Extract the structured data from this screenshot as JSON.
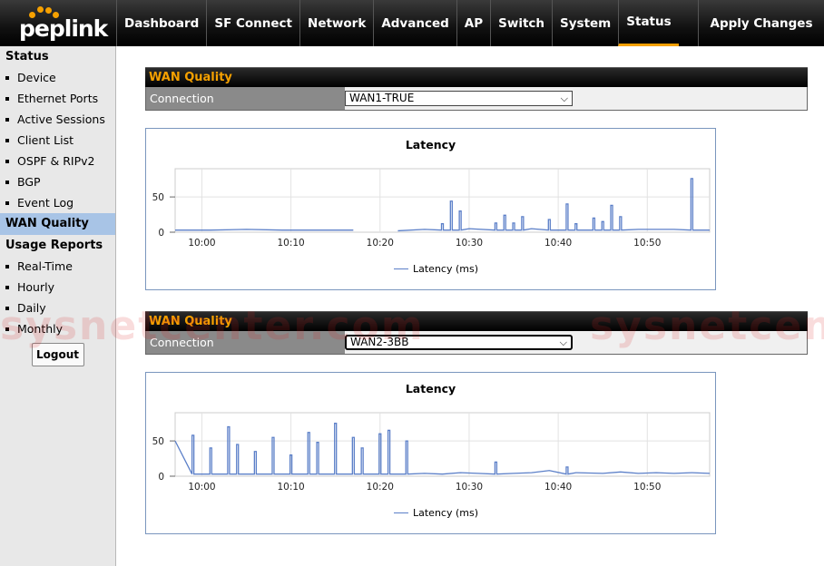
{
  "brand": {
    "logo_text": "peplink",
    "accent": "#f5a000"
  },
  "nav": {
    "items": [
      "Dashboard",
      "SF Connect",
      "Network",
      "Advanced",
      "AP",
      "Switch",
      "System",
      "Status"
    ],
    "active": "Status",
    "apply_label": "Apply Changes"
  },
  "sidebar": {
    "status_header": "Status",
    "status_items": [
      "Device",
      "Ethernet Ports",
      "Active Sessions",
      "Client List",
      "OSPF & RIPv2",
      "BGP",
      "Event Log"
    ],
    "active_item": "WAN Quality",
    "reports_header": "Usage Reports",
    "report_items": [
      "Real-Time",
      "Hourly",
      "Daily",
      "Monthly"
    ],
    "logout_label": "Logout"
  },
  "panels": [
    {
      "title": "WAN Quality",
      "connection_label": "Connection",
      "selected": "WAN1-TRUE",
      "chart": {
        "title": "Latency",
        "legend": "Latency (ms)",
        "y_ticks": [
          "0",
          "50"
        ],
        "x_ticks": [
          "10:00",
          "10:10",
          "10:20",
          "10:30",
          "10:40",
          "10:50"
        ]
      }
    },
    {
      "title": "WAN Quality",
      "connection_label": "Connection",
      "selected": "WAN2-3BB",
      "chart": {
        "title": "Latency",
        "legend": "Latency (ms)",
        "y_ticks": [
          "0",
          "50"
        ],
        "x_ticks": [
          "10:00",
          "10:10",
          "10:20",
          "10:30",
          "10:40",
          "10:50"
        ]
      }
    }
  ],
  "watermark": "sysnetcenter.com",
  "chart_data": [
    {
      "type": "line",
      "title": "Latency",
      "series": [
        {
          "name": "Latency (ms)"
        }
      ],
      "x_range": [
        "09:57",
        "10:57"
      ],
      "ylim": [
        0,
        90
      ],
      "grid": true,
      "legend": "bottom",
      "x": [
        0,
        4,
        8,
        12,
        16,
        20,
        21.5,
        25,
        28,
        30,
        31,
        32,
        33,
        36,
        37,
        38,
        39,
        40,
        42,
        44,
        45,
        47,
        48,
        49,
        50,
        52,
        54,
        56,
        58,
        60
      ],
      "y": [
        3,
        3,
        4,
        3,
        3,
        3,
        null,
        2,
        4,
        12,
        44,
        30,
        5,
        13,
        24,
        13,
        22,
        5,
        18,
        40,
        12,
        20,
        15,
        38,
        22,
        4,
        4,
        4,
        76,
        3
      ]
    },
    {
      "type": "line",
      "title": "Latency",
      "series": [
        {
          "name": "Latency (ms)"
        }
      ],
      "x_range": [
        "09:57",
        "10:57"
      ],
      "ylim": [
        0,
        90
      ],
      "grid": true,
      "legend": "bottom",
      "x": [
        0,
        2,
        4,
        6,
        7,
        9,
        11,
        13,
        15,
        16,
        18,
        20,
        21,
        23,
        24,
        26,
        28,
        30,
        32,
        34,
        36,
        38,
        40,
        42,
        44,
        45,
        48,
        50,
        52,
        54,
        56,
        58,
        60
      ],
      "y": [
        50,
        58,
        40,
        70,
        45,
        35,
        55,
        30,
        62,
        48,
        75,
        55,
        40,
        60,
        65,
        50,
        4,
        3,
        5,
        4,
        20,
        4,
        5,
        8,
        13,
        5,
        4,
        6,
        4,
        5,
        4,
        5,
        4
      ]
    }
  ]
}
